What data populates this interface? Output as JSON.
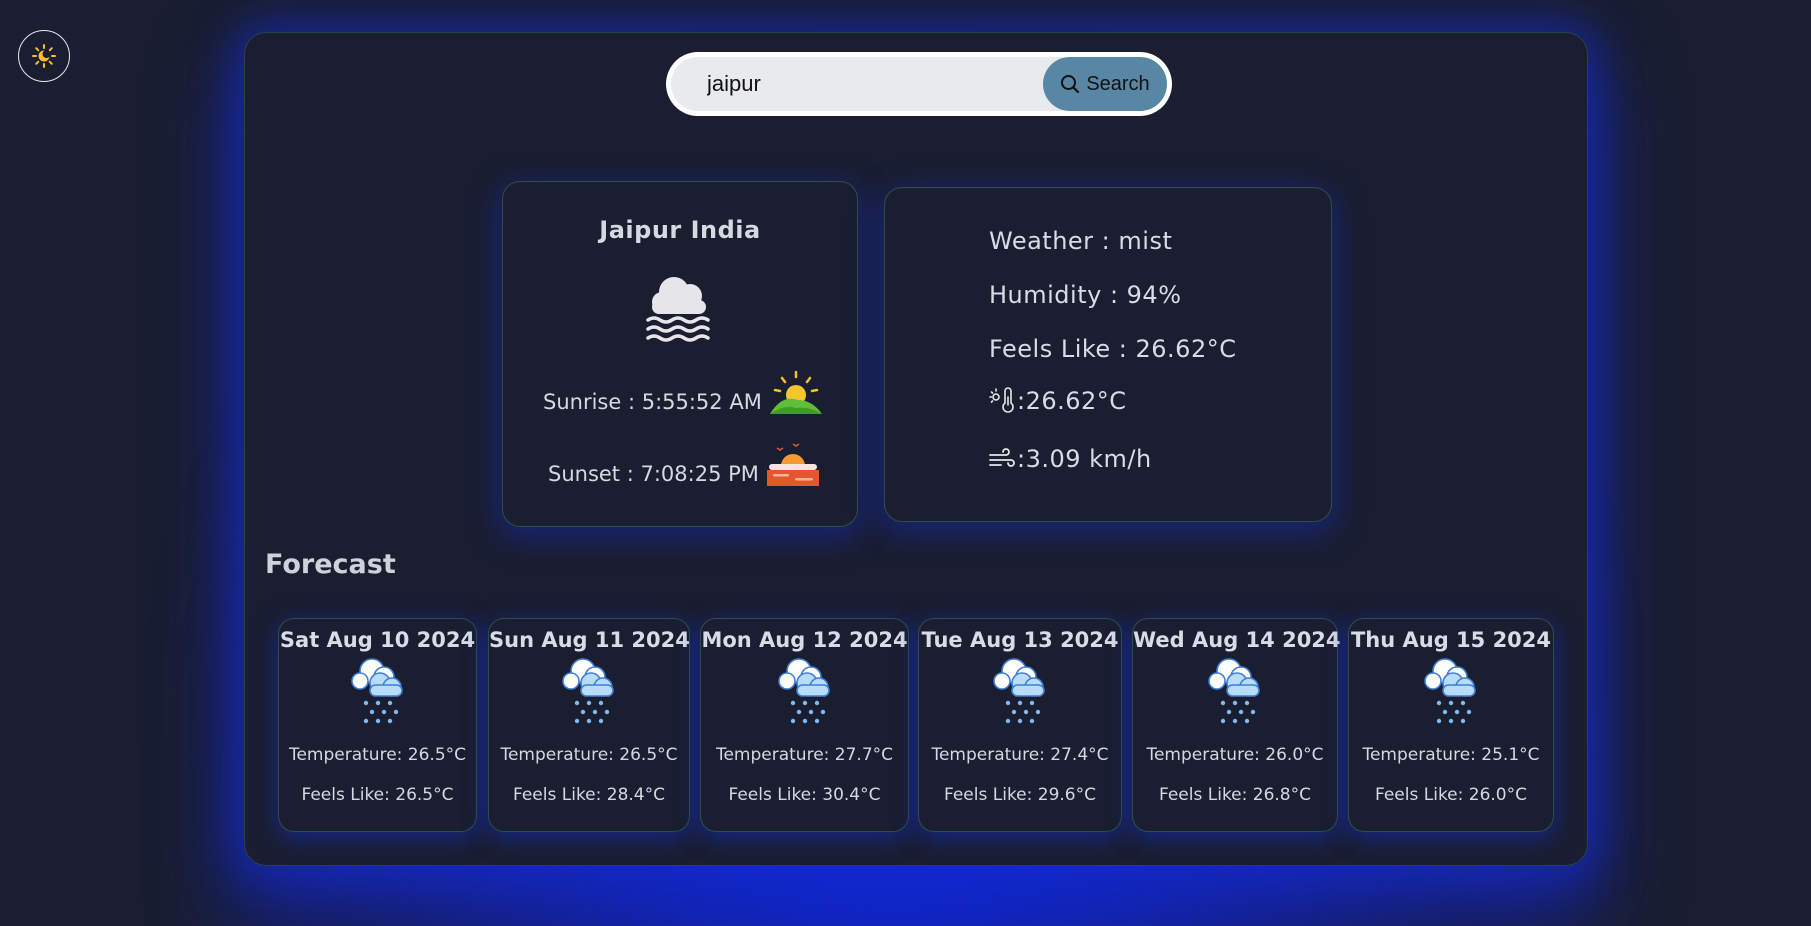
{
  "search": {
    "value": "jaipur",
    "button_label": "Search"
  },
  "current": {
    "city": "Jaipur India",
    "sunrise": "Sunrise : 5:55:52 AM",
    "sunset": "Sunset : 7:08:25 PM",
    "weather": "Weather : mist",
    "humidity": "Humidity : 94%",
    "feels_like": "Feels Like : 26.62°C",
    "temperature": ":26.62°C",
    "wind": ":3.09 km/h"
  },
  "forecast": {
    "title": "Forecast",
    "days": [
      {
        "date": "Sat Aug 10 2024",
        "temp": "Temperature: 26.5°C",
        "feels": "Feels Like: 26.5°C"
      },
      {
        "date": "Sun Aug 11 2024",
        "temp": "Temperature: 26.5°C",
        "feels": "Feels Like: 28.4°C"
      },
      {
        "date": "Mon Aug 12 2024",
        "temp": "Temperature: 27.7°C",
        "feels": "Feels Like: 30.4°C"
      },
      {
        "date": "Tue Aug 13 2024",
        "temp": "Temperature: 27.4°C",
        "feels": "Feels Like: 29.6°C"
      },
      {
        "date": "Wed Aug 14 2024",
        "temp": "Temperature: 26.0°C",
        "feels": "Feels Like: 26.8°C"
      },
      {
        "date": "Thu Aug 15 2024",
        "temp": "Temperature: 25.1°C",
        "feels": "Feels Like: 26.0°C"
      }
    ]
  },
  "icons": {
    "theme_toggle": "sun-moon-icon",
    "search": "magnifier-icon",
    "current_condition": "mist-icon",
    "sunrise": "sunrise-icon",
    "sunset": "sunset-icon",
    "temperature": "thermometer-icon",
    "wind": "wind-icon",
    "forecast_condition": "snow-cloud-icon"
  },
  "colors": {
    "background": "#1a1e30",
    "glow": "#1228d2",
    "search_button": "#5787a4",
    "toggle_icon": "#f2c12e"
  }
}
